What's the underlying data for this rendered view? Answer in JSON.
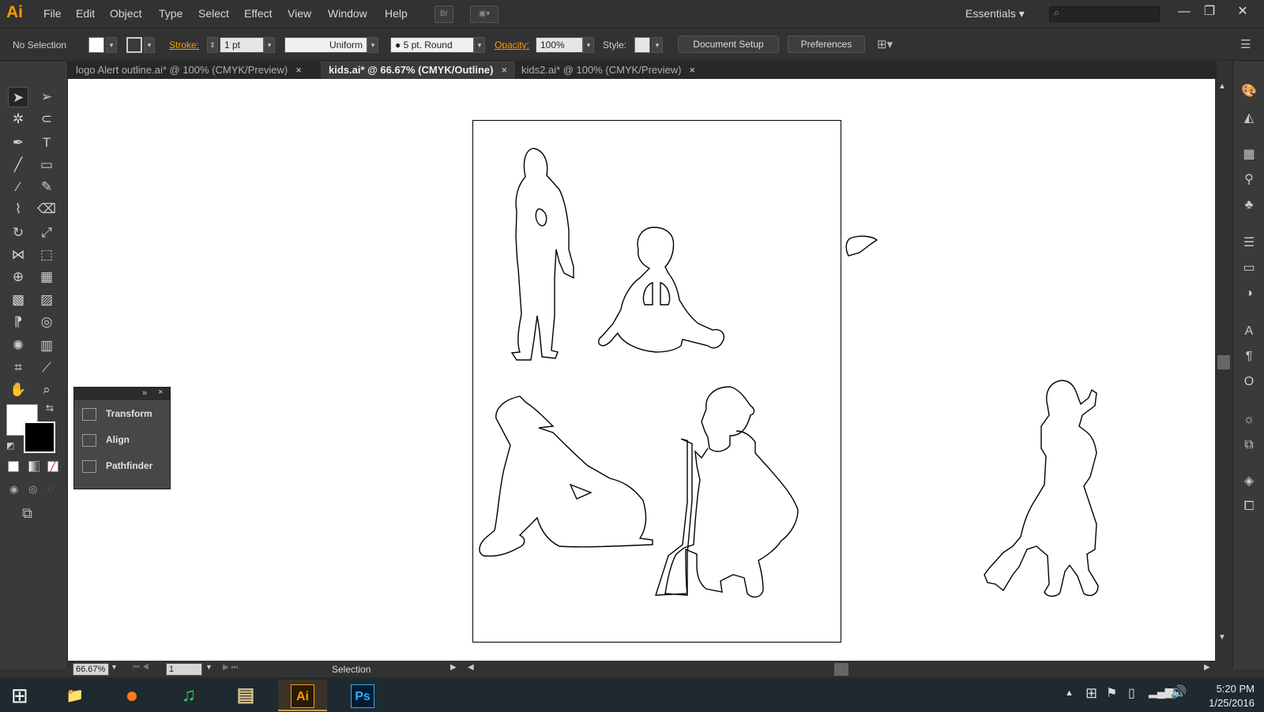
{
  "app": {
    "logo": "Ai",
    "accent": "#ff9a00"
  },
  "menu": [
    "File",
    "Edit",
    "Object",
    "Type",
    "Select",
    "Effect",
    "View",
    "Window",
    "Help"
  ],
  "menubar_buttons": {
    "bridge": "Br",
    "arrange": "▣▾"
  },
  "workspace": {
    "label": "Essentials ▾",
    "search_icon": "⌕"
  },
  "window_controls": {
    "minimize": "—",
    "restore": "❐",
    "close": "✕"
  },
  "control_bar": {
    "selection": "No Selection",
    "stroke_label": "Stroke:",
    "stroke_weight": "1 pt",
    "profile": "Uniform",
    "brush": "● 5 pt. Round",
    "opacity_label": "Opacity:",
    "opacity_value": "100%",
    "style_label": "Style:",
    "document_setup": "Document Setup",
    "preferences": "Preferences"
  },
  "tabs": [
    {
      "label": "logo Alert outline.ai* @ 100% (CMYK/Preview)",
      "close": "×"
    },
    {
      "label": "kids.ai* @ 66.67% (CMYK/Outline)",
      "close": "×",
      "active": true
    },
    {
      "label": "kids2.ai* @ 100% (CMYK/Preview)",
      "close": "×"
    }
  ],
  "panel": {
    "items": [
      "Transform",
      "Align",
      "Pathfinder"
    ],
    "collapse": "»",
    "close": "×"
  },
  "status": {
    "zoom": "66.67%",
    "artboard": "1",
    "mode": "Selection"
  },
  "taskbar": {
    "apps": [
      {
        "name": "explorer",
        "label": "📁"
      },
      {
        "name": "firefox",
        "label": "●"
      },
      {
        "name": "spotify",
        "label": "♫"
      },
      {
        "name": "notepad",
        "label": "▤"
      },
      {
        "name": "illustrator",
        "label": "Ai"
      },
      {
        "name": "photoshop",
        "label": "Ps"
      }
    ],
    "time": "5:20 PM",
    "date": "1/25/2016"
  }
}
